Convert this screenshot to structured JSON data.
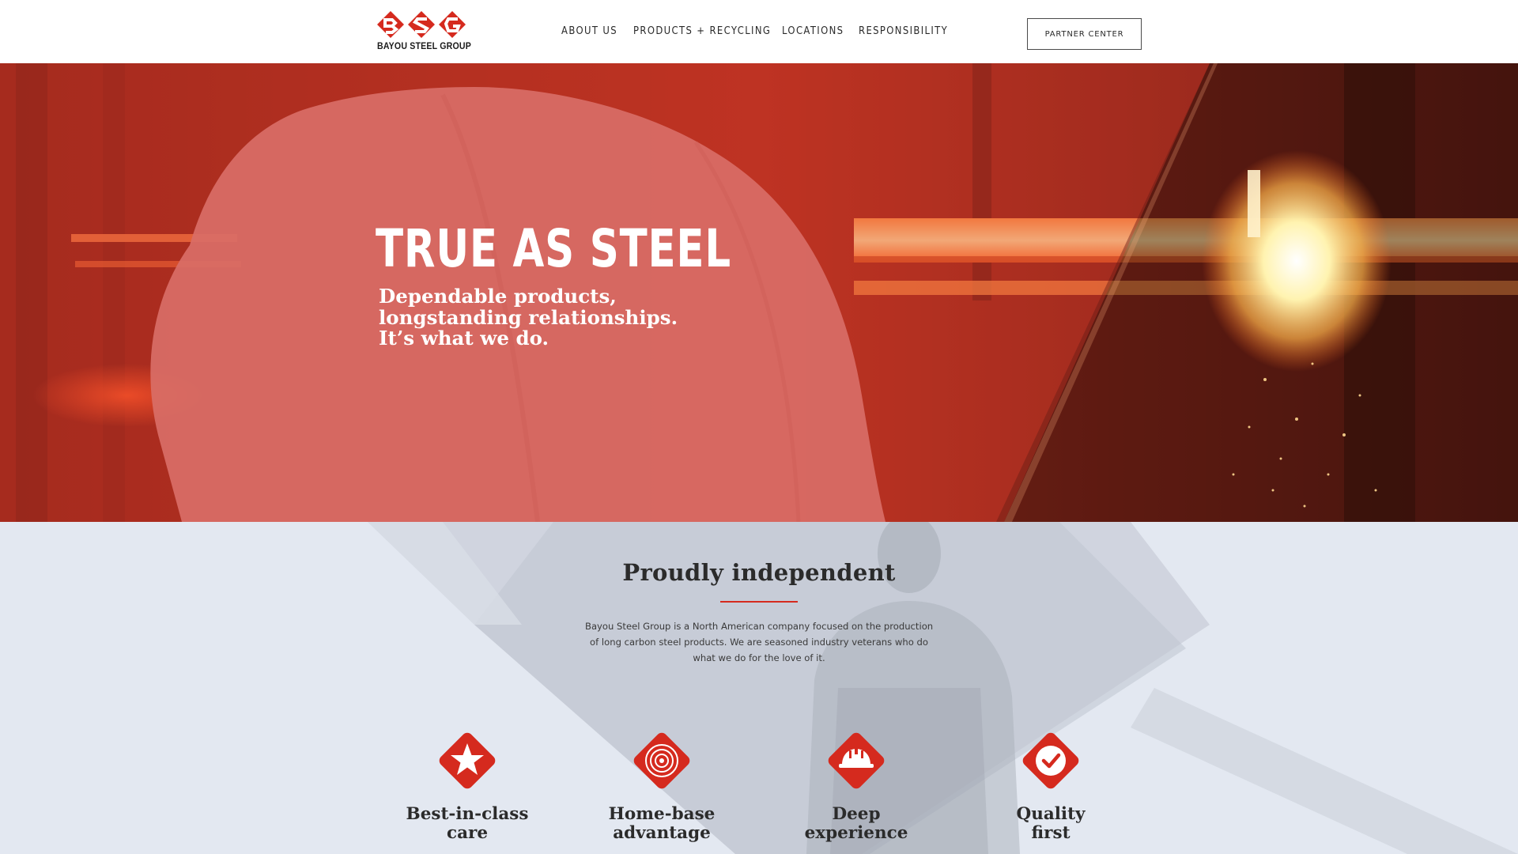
{
  "brand": {
    "name": "BAYOU STEEL GROUP",
    "logo_letters": "BSG",
    "accent_color": "#d52a1e"
  },
  "nav": {
    "items": [
      {
        "label": "ABOUT US"
      },
      {
        "label": "PRODUCTS + RECYCLING"
      },
      {
        "label": "LOCATIONS"
      },
      {
        "label": "RESPONSIBILITY"
      }
    ],
    "partner_button": "PARTNER CENTER"
  },
  "hero": {
    "title": "TRUE AS STEEL",
    "subtitle_lines": [
      "Dependable products,",
      "longstanding relationships.",
      "It’s what we do."
    ]
  },
  "about": {
    "heading": "Proudly independent",
    "body_lines": [
      "Bayou Steel Group is a North American company focused on the production",
      "of long carbon steel products. We are seasoned industry veterans who do",
      "what we do for the love of it."
    ]
  },
  "features": [
    {
      "icon": "star-icon",
      "label_lines": [
        "Best-in-class",
        "care"
      ]
    },
    {
      "icon": "target-rings-icon",
      "label_lines": [
        "Home-base",
        "advantage"
      ]
    },
    {
      "icon": "hard-hat-icon",
      "label_lines": [
        "Deep",
        "experience"
      ]
    },
    {
      "icon": "checkmark-icon",
      "label_lines": [
        "Quality",
        "first"
      ]
    }
  ]
}
